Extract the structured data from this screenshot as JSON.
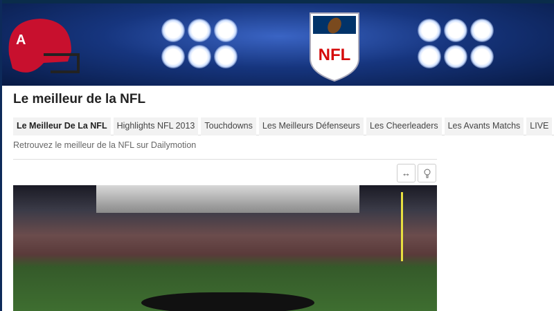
{
  "banner": {
    "logo_text": "NFL"
  },
  "page": {
    "title": "Le meilleur de la NFL",
    "description": "Retrouvez le meilleur de la NFL sur Dailymotion"
  },
  "tabs": [
    {
      "label": "Le Meilleur De La NFL",
      "active": true
    },
    {
      "label": "Highlights NFL 2013"
    },
    {
      "label": "Touchdowns"
    },
    {
      "label": "Les Meilleurs Défenseurs"
    },
    {
      "label": "Les Cheerleaders"
    },
    {
      "label": "Les Avants Matchs"
    },
    {
      "label": "LIVE"
    }
  ],
  "toolbar": {
    "expand_icon": "↔",
    "light_icon": "bulb-icon"
  }
}
